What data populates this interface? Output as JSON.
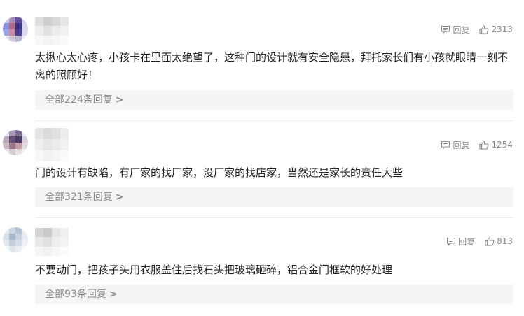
{
  "comments": [
    {
      "like_count": "2313",
      "reply_label": "回复",
      "text": "太揪心太心疼，小孩卡在里面太绝望了，这种门的设计就有安全隐患，拜托家长们有小孩就眼睛一刻不离的照顾好！",
      "replies_prefix": "全部",
      "replies_count": "224",
      "replies_suffix": "条回复",
      "replies_arrow": ">"
    },
    {
      "like_count": "1254",
      "reply_label": "回复",
      "text": "门的设计有缺陷，有厂家的找厂家，没厂家的找店家，当然还是家长的责任大些",
      "replies_prefix": "全部",
      "replies_count": "321",
      "replies_suffix": "条回复",
      "replies_arrow": ">"
    },
    {
      "like_count": "813",
      "reply_label": "回复",
      "text": "不要动门，把孩子头用衣服盖住后找石头把玻璃砸碎，铝合金门框软的好处理",
      "replies_prefix": "全部",
      "replies_count": "93",
      "replies_suffix": "条回复",
      "replies_arrow": ">"
    }
  ],
  "icons": {
    "reply": "reply-icon",
    "like": "thumbs-up-icon"
  },
  "colors": {
    "text": "#222222",
    "meta": "#888888",
    "reply_bar_bg": "#f4f5f6",
    "divider": "#ececec"
  }
}
